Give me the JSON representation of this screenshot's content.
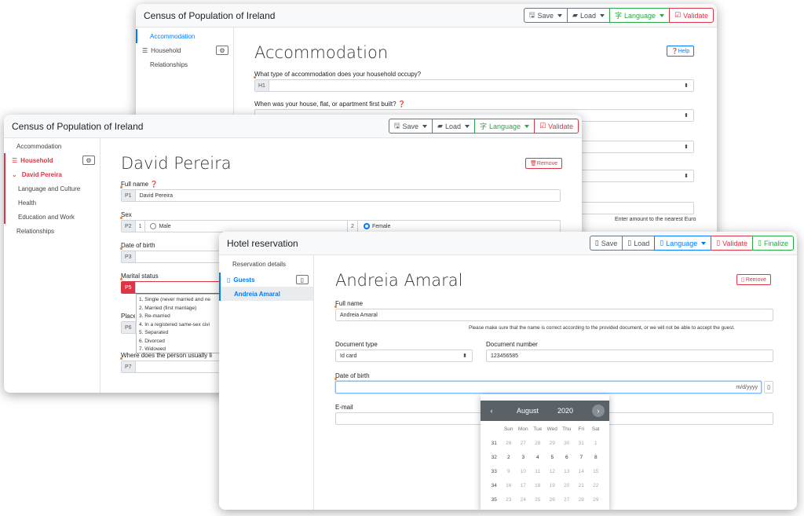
{
  "census_back": {
    "title": "Census of Population of Ireland",
    "toolbar": {
      "save": "Save",
      "load": "Load",
      "language": "Language",
      "validate": "Validate"
    },
    "sidebar": {
      "accommodation": "Accommodation",
      "household": "Household",
      "relationships": "Relationships"
    },
    "heading": "Accommodation",
    "help": "Help",
    "q1": {
      "label": "What type of accommodation does your household occupy?",
      "code": "H1"
    },
    "q2": {
      "label": "When was your house, flat, or apartment first built?"
    },
    "hint": "Enter amount to the nearest Euro"
  },
  "census_front": {
    "title": "Census of Population of Ireland",
    "toolbar": {
      "save": "Save",
      "load": "Load",
      "language": "Language",
      "validate": "Validate"
    },
    "sidebar": {
      "accommodation": "Accommodation",
      "household": "Household",
      "person": "David Pereira",
      "language": "Language and Culture",
      "health": "Health",
      "education": "Education and Work",
      "relationships": "Relationships"
    },
    "heading": "David Pereira",
    "remove": "Remove",
    "full_name": {
      "label": "Full name",
      "code": "P1",
      "value": "David Pereira"
    },
    "sex": {
      "label": "Sex",
      "code": "P2",
      "opt1_num": "1",
      "opt1": "Male",
      "opt2_num": "2",
      "opt2": "Female"
    },
    "dob": {
      "label": "Date of birth",
      "code": "P3"
    },
    "marital": {
      "label": "Marital status",
      "code": "P5",
      "options": [
        "1. Single (never married and ne",
        "2. Married (first marriage)",
        "3. Re-married",
        "4. In a registered same-sex civi",
        "5. Separated",
        "6. Divorced",
        "7. Widowed"
      ]
    },
    "place": {
      "label": "Place",
      "code": "P6"
    },
    "where": {
      "label": "Where does the person usually li",
      "code": "P7"
    }
  },
  "hotel": {
    "title": "Hotel reservation",
    "toolbar": {
      "save": "Save",
      "load": "Load",
      "language": "Language",
      "validate": "Validate",
      "finalize": "Finalize"
    },
    "sidebar": {
      "details": "Reservation details",
      "guests": "Guests",
      "guest": "Andreia Amaral"
    },
    "heading": "Andreia Amaral",
    "remove": "Remove",
    "full_name": {
      "label": "Full name",
      "value": "Andreia Amaral"
    },
    "note": "Please make sure that the name is correct according to the provided document, or we will not be able to accept the guest.",
    "doc_type": {
      "label": "Document type",
      "value": "Id card"
    },
    "doc_number": {
      "label": "Document number",
      "value": "123456585"
    },
    "dob": {
      "label": "Date of birth",
      "placeholder": "m/d/yyyy"
    },
    "email": {
      "label": "E-mail"
    },
    "calendar": {
      "month": "August",
      "year": "2020",
      "days": [
        "Sun",
        "Mon",
        "Tue",
        "Wed",
        "Thu",
        "Fri",
        "Sat"
      ],
      "weeks": [
        {
          "wk": "31",
          "d": [
            "26",
            "27",
            "28",
            "29",
            "30",
            "31",
            "1"
          ]
        },
        {
          "wk": "32",
          "d": [
            "2",
            "3",
            "4",
            "5",
            "6",
            "7",
            "8"
          ]
        },
        {
          "wk": "33",
          "d": [
            "9",
            "10",
            "11",
            "12",
            "13",
            "14",
            "15"
          ]
        },
        {
          "wk": "34",
          "d": [
            "16",
            "17",
            "18",
            "19",
            "20",
            "21",
            "22"
          ]
        },
        {
          "wk": "35",
          "d": [
            "23",
            "24",
            "25",
            "26",
            "27",
            "28",
            "29"
          ]
        }
      ]
    }
  },
  "colors": {
    "primary": "#007bff",
    "danger": "#dc3545",
    "success": "#28a745",
    "warning_dot": "#fd7e14"
  }
}
